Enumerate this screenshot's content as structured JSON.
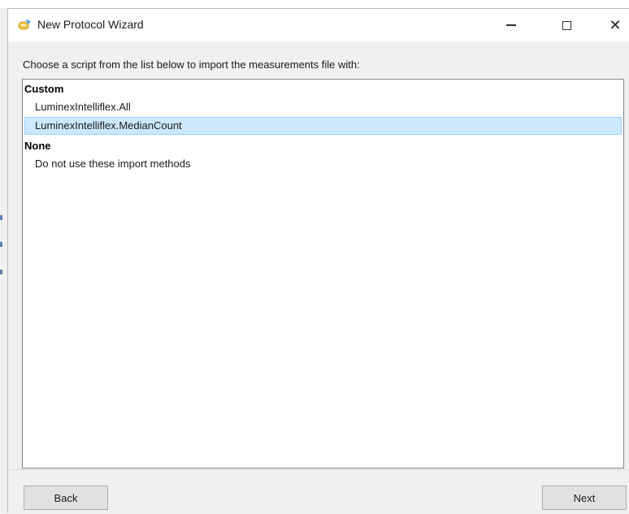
{
  "window": {
    "title": "New Protocol Wizard",
    "icon": "wizard-wand-icon"
  },
  "controls": {
    "minimize_icon": "minimize-icon",
    "maximize_icon": "maximize-icon",
    "close_icon": "close-icon",
    "close_glyph": "✕"
  },
  "instruction": "Choose a script from the list below to import the measurements file with:",
  "list": {
    "groups": [
      {
        "header": "Custom",
        "items": [
          "LuminexIntelliflex.All",
          "LuminexIntelliflex.MedianCount"
        ]
      },
      {
        "header": "None",
        "items": [
          "Do not use these import methods"
        ]
      }
    ],
    "selected": "LuminexIntelliflex.MedianCount",
    "selection_color": "#cce8ff",
    "selection_border_color": "#99d1ff"
  },
  "buttons": {
    "back": "Back",
    "next": "Next"
  }
}
